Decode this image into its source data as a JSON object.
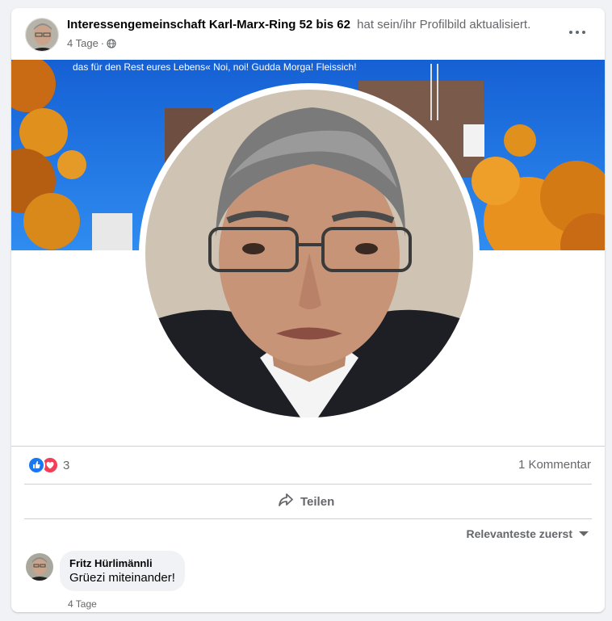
{
  "post": {
    "page_name": "Interessengemeinschaft Karl-Marx-Ring 52 bis 62",
    "action": "hat sein/ihr Profilbild aktualisiert.",
    "time": "4 Tage",
    "separator": "·",
    "privacy_icon": "globe-icon",
    "more_icon": "more-options-icon"
  },
  "cover": {
    "caption": "das für den Rest eures Lebens« Noi, noi! Gudda Morga! Fleissich!"
  },
  "engagement": {
    "reaction_icons": [
      "like-icon",
      "love-icon"
    ],
    "reaction_count": "3",
    "comment_count": "1 Kommentar",
    "share_label": "Teilen",
    "sort_label": "Relevanteste zuerst"
  },
  "comment": {
    "author": "Fritz Hürlimännli",
    "text": "Grüezi miteinander!",
    "time": "4 Tage"
  },
  "colors": {
    "like_blue": "#1877f2",
    "love_red": "#f33e58",
    "sky_blue": "#1a73e0",
    "foliage": "#e8911e"
  }
}
